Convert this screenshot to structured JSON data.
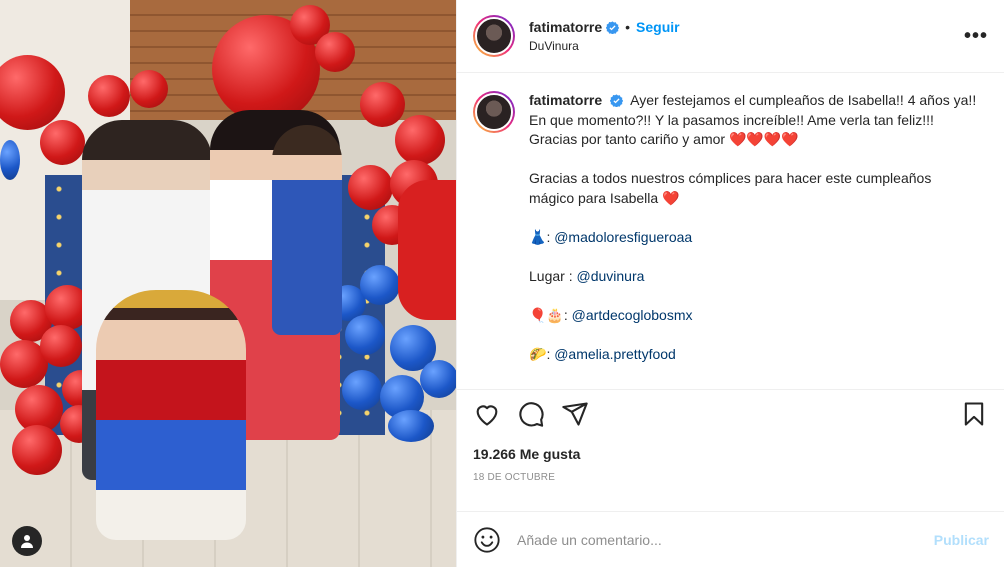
{
  "post": {
    "username": "fatimatorre",
    "follow_label": "Seguir",
    "separator": "•",
    "location": "DuVinura",
    "more_label": "•••"
  },
  "caption": {
    "username": "fatimatorre",
    "p1": "Ayer festejamos el cumpleaños de Isabella!! 4 años ya!! En que momento?!! Y la pasamos increíble!! Ame verla tan feliz!!! Gracias por tanto cariño y amor",
    "p1_hearts": "❤️❤️❤️❤️",
    "p2": "Gracias a todos nuestros cómplices para hacer este cumpleaños mágico para Isabella",
    "p2_heart": "❤️",
    "line_dress_emoji": "👗",
    "line_dress_mention": "@madoloresfigueroaa",
    "line_place_label": "Lugar :",
    "line_place_mention": "@duvinura",
    "line_balloon_emoji": "🎈🎂",
    "line_balloon_mention": "@artdecoglobosmx",
    "line_food_emoji": "🌮",
    "line_food_mention": "@amelia.prettyfood"
  },
  "stats": {
    "likes": "19.266 Me gusta",
    "date": "18 DE OCTUBRE"
  },
  "comment": {
    "placeholder": "Añade un comentario...",
    "publish_label": "Publicar"
  },
  "colors": {
    "accent": "#0095f6",
    "mention": "#00376b",
    "muted": "#8e8e8e",
    "publish_disabled": "#b2dffc"
  },
  "icons": [
    "verified-badge-icon",
    "heart-icon",
    "comment-icon",
    "share-icon",
    "bookmark-icon",
    "emoji-icon",
    "user-tag-icon",
    "more-options-icon"
  ]
}
